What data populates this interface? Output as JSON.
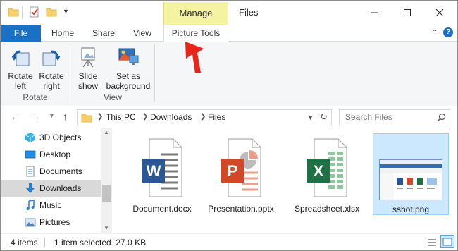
{
  "window": {
    "title": "Files",
    "context_tab": "Manage"
  },
  "ribbon": {
    "tabs": {
      "file": "File",
      "home": "Home",
      "share": "Share",
      "view": "View",
      "picture_tools": "Picture Tools"
    },
    "groups": {
      "rotate": {
        "label": "Rotate",
        "rotate_left": [
          "Rotate",
          "left"
        ],
        "rotate_right": [
          "Rotate",
          "right"
        ]
      },
      "view": {
        "label": "View",
        "slide_show": [
          "Slide",
          "show"
        ],
        "set_as_background": [
          "Set as",
          "background"
        ]
      }
    },
    "help": "?"
  },
  "address": {
    "crumbs": [
      "This PC",
      "Downloads",
      "Files"
    ],
    "search_placeholder": "Search Files"
  },
  "nav_pane": {
    "items": [
      {
        "label": "3D Objects",
        "icon": "3d-objects-icon"
      },
      {
        "label": "Desktop",
        "icon": "desktop-icon"
      },
      {
        "label": "Documents",
        "icon": "documents-icon"
      },
      {
        "label": "Downloads",
        "icon": "downloads-icon",
        "selected": true
      },
      {
        "label": "Music",
        "icon": "music-icon"
      },
      {
        "label": "Pictures",
        "icon": "pictures-icon"
      }
    ]
  },
  "files": [
    {
      "name": "Document.docx",
      "icon": "word-file-icon",
      "letter": "W",
      "color": "#2b5797"
    },
    {
      "name": "Presentation.pptx",
      "icon": "powerpoint-file-icon",
      "letter": "P",
      "color": "#d24726"
    },
    {
      "name": "Spreadsheet.xlsx",
      "icon": "excel-file-icon",
      "letter": "X",
      "color": "#1e7145"
    },
    {
      "name": "sshot.png",
      "icon": "image-thumbnail",
      "selected": true
    }
  ],
  "status": {
    "count": "4 items",
    "selection": "1 item selected  27.0 KB"
  },
  "colors": {
    "accent": "#1a70c4",
    "manage_tab": "#f4f3a2",
    "selection": "#cce8ff",
    "annotation_arrow": "#e8241b"
  }
}
